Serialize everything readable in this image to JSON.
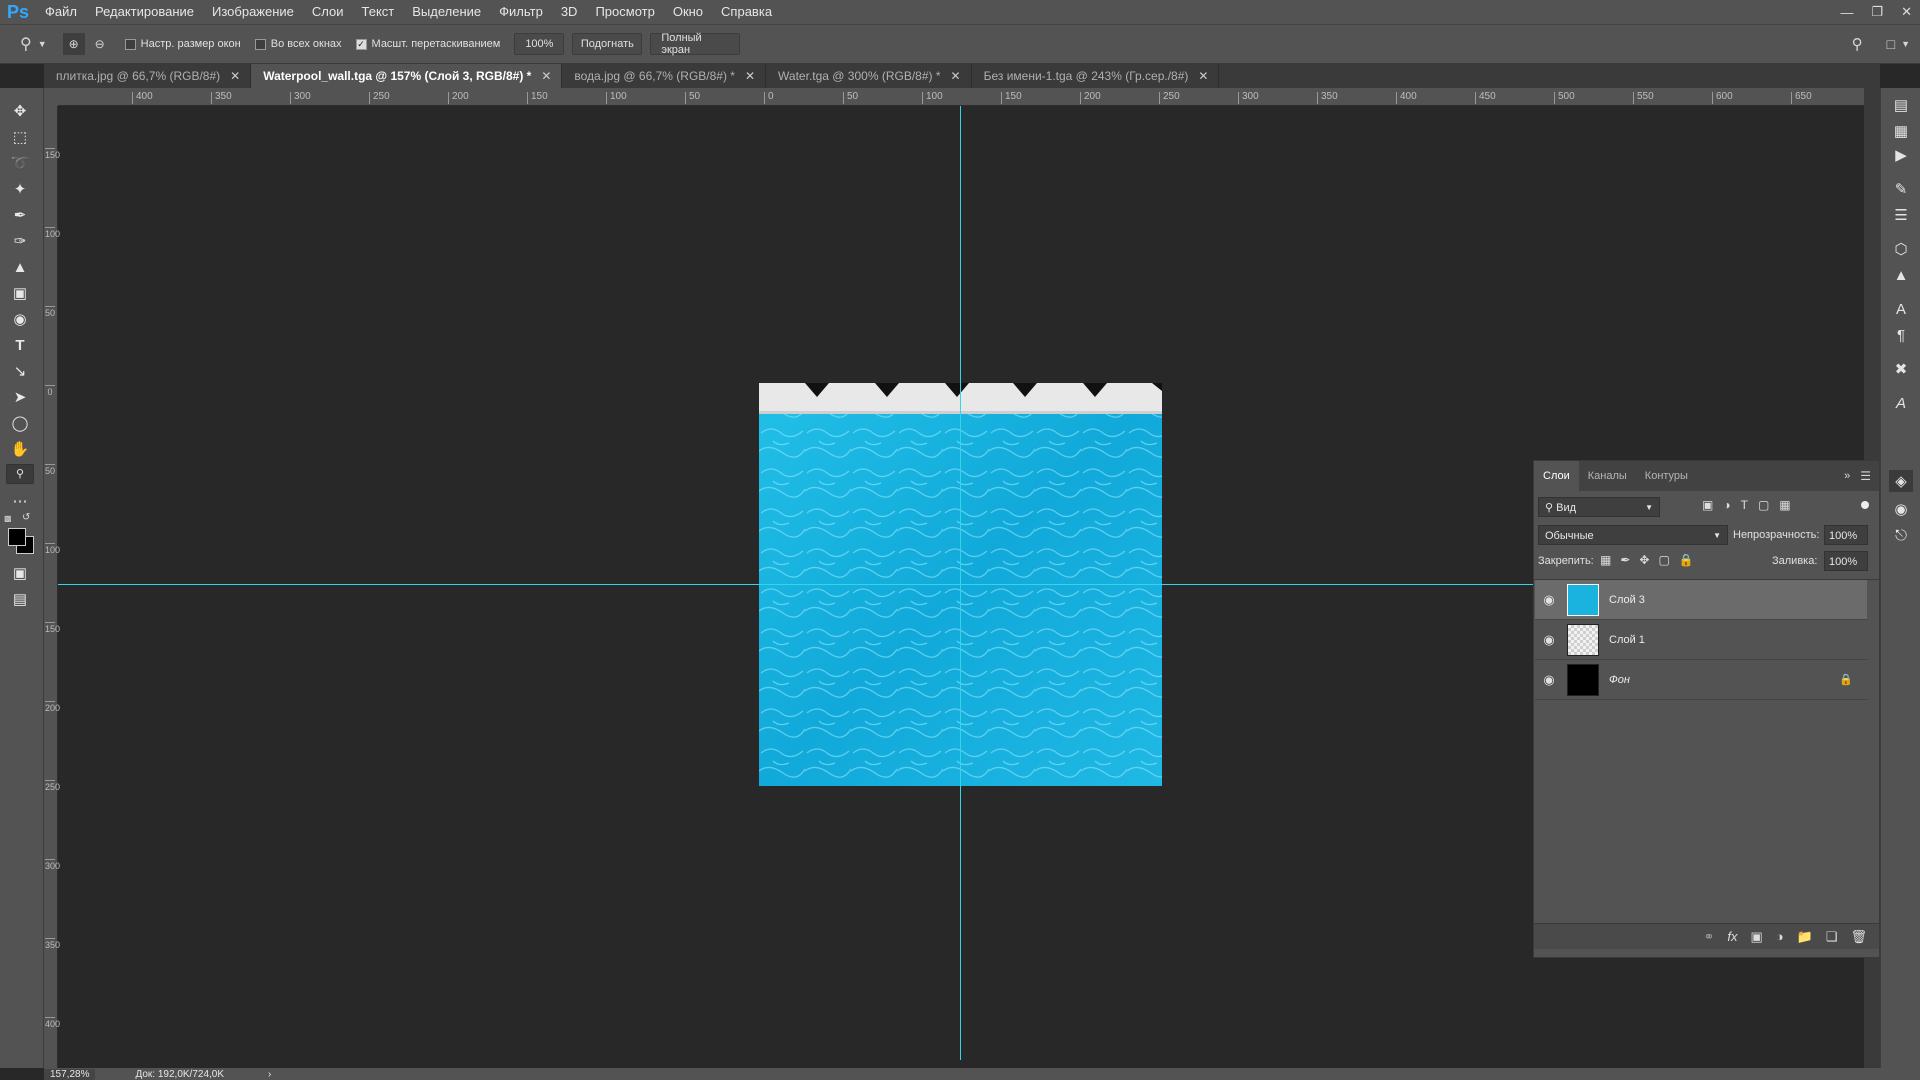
{
  "app": {
    "logo": "Ps",
    "accent": "#31a8ff"
  },
  "menu": [
    "Файл",
    "Редактирование",
    "Изображение",
    "Слои",
    "Текст",
    "Выделение",
    "Фильтр",
    "3D",
    "Просмотр",
    "Окно",
    "Справка"
  ],
  "options": {
    "resize_windows": "Настр. размер окон",
    "all_windows": "Во всех окнах",
    "scrubby_zoom": "Масшт. перетаскиванием",
    "zoom_value": "100%",
    "fit": "Подогнать",
    "fullscreen": "Полный экран"
  },
  "tabs": [
    "плитка.jpg @ 66,7% (RGB/8#)",
    "Waterpool_wall.tga @ 157% (Слой 3, RGB/8#) *",
    "вода.jpg @ 66,7% (RGB/8#) *",
    "Water.tga @ 300% (RGB/8#) *",
    "Без имени-1.tga @ 243% (Гр.сер./8#)"
  ],
  "ruler_h": [
    "400",
    "350",
    "300",
    "250",
    "200",
    "150",
    "100",
    "50",
    "0",
    "50",
    "100",
    "150",
    "200",
    "250",
    "300",
    "350",
    "400",
    "450",
    "500",
    "550",
    "600",
    "650"
  ],
  "ruler_v": [
    "150",
    "100",
    "50",
    "0",
    "50",
    "100",
    "150",
    "200",
    "250",
    "300",
    "350",
    "400"
  ],
  "guide_color": "#33d6e6",
  "layers_panel": {
    "tabs": [
      "Слои",
      "Каналы",
      "Контуры"
    ],
    "filter_kind": "Вид",
    "blend_mode": "Обычные",
    "opacity_label": "Непрозрачность:",
    "opacity_value": "100%",
    "lock_label": "Закрепить:",
    "fill_label": "Заливка:",
    "fill_value": "100%",
    "layers": [
      {
        "name": "Слой 3",
        "selected": true
      },
      {
        "name": "Слой 1",
        "selected": false
      },
      {
        "name": "Фон",
        "selected": false,
        "locked": true
      }
    ]
  },
  "status": {
    "zoom": "157,28%",
    "doc": "Док: 192,0K/724,0K"
  }
}
